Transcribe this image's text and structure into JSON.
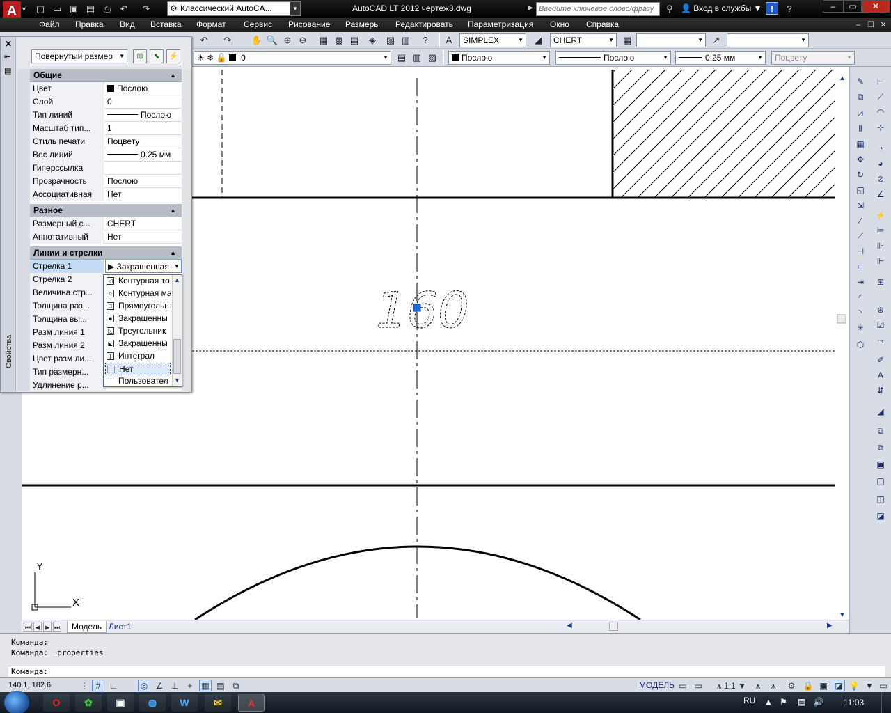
{
  "titlebar": {
    "workspace": "Классический AutoCA...",
    "title": "AutoCAD LT 2012    чертеж3.dwg",
    "search_placeholder": "Введите ключевое слово/фразу",
    "login": "Вход в службы"
  },
  "menu": [
    "Файл",
    "Правка",
    "Вид",
    "Вставка",
    "Формат",
    "Сервис",
    "Рисование",
    "Размеры",
    "Редактировать",
    "Параметризация",
    "Окно",
    "Справка"
  ],
  "toolbar1": {
    "text_style": "SIMPLEX",
    "dim_style": "CHERT",
    "table_style": "",
    "mleader_style": ""
  },
  "toolbar2": {
    "layer": "0",
    "color": "Послою",
    "linetype": "Послою",
    "lineweight": "0.25 мм",
    "plotstyle": "Поцвету"
  },
  "properties": {
    "side_label": "Свойства",
    "object_type": "Повернутый размер",
    "categories": {
      "general": "Общие",
      "misc": "Разное",
      "lines": "Линии и стрелки"
    },
    "general": [
      {
        "name": "Цвет",
        "value": "Послою"
      },
      {
        "name": "Слой",
        "value": "0"
      },
      {
        "name": "Тип линий",
        "value": "Послою"
      },
      {
        "name": "Масштаб тип...",
        "value": "1"
      },
      {
        "name": "Стиль печати",
        "value": "Поцвету"
      },
      {
        "name": "Вес линий",
        "value": "0.25 мм"
      },
      {
        "name": "Гиперссылка",
        "value": ""
      },
      {
        "name": "Прозрачность",
        "value": "Послою"
      },
      {
        "name": "Ассоциативная",
        "value": "Нет"
      }
    ],
    "misc": [
      {
        "name": "Размерный с...",
        "value": "CHERT"
      },
      {
        "name": "Аннотативный",
        "value": "Нет"
      }
    ],
    "lines": [
      {
        "name": "Стрелка 1",
        "value": "Закрашенная"
      },
      {
        "name": "Стрелка 2",
        "value": ""
      },
      {
        "name": "Величина стр...",
        "value": ""
      },
      {
        "name": "Толщина раз...",
        "value": ""
      },
      {
        "name": "Толщина вы...",
        "value": ""
      },
      {
        "name": "Разм линия 1",
        "value": ""
      },
      {
        "name": "Разм линия 2",
        "value": ""
      },
      {
        "name": "Цвет разм ли...",
        "value": ""
      },
      {
        "name": "Тип размерн...",
        "value": ""
      },
      {
        "name": "Удлинение р...",
        "value": ""
      }
    ],
    "dropdown_options": [
      "Контурная то",
      "Контурная ма",
      "Прямоугольн",
      "Закрашенны",
      "Треугольник",
      "Закрашенны",
      "Интеграл",
      "Нет",
      "Пользовател"
    ],
    "dropdown_selected": "Нет"
  },
  "drawing": {
    "dimension_text": "160",
    "ucs_x": "X",
    "ucs_y": "Y"
  },
  "tabs": [
    "Модель",
    "Лист1"
  ],
  "command": {
    "line1": "Команда:",
    "line2": "Команда:  _properties",
    "prompt": "Команда:"
  },
  "status": {
    "coords": "140.1, 182.6",
    "space": "МОДЕЛЬ",
    "annoscale": "1:1"
  },
  "taskbar": {
    "lang": "RU",
    "clock": "11:03"
  }
}
